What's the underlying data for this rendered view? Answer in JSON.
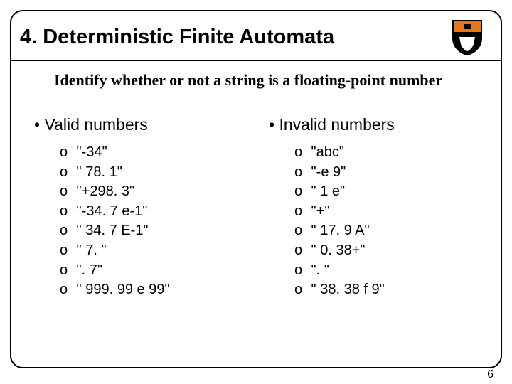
{
  "title": "4. Deterministic Finite Automata",
  "subtitle": "Identify whether or not a string is a floating-point number",
  "columns": [
    {
      "heading": "Valid numbers",
      "items": [
        "\"-34\"",
        "\" 78. 1\"",
        "\"+298. 3\"",
        "\"-34. 7 e-1\"",
        "\" 34. 7 E-1\"",
        "\" 7. \"",
        "\". 7\"",
        "\" 999. 99 e 99\""
      ]
    },
    {
      "heading": "Invalid numbers",
      "items": [
        "\"abc\"",
        "\"-e 9\"",
        "\" 1 e\"",
        "\"+\"",
        "\" 17. 9 A\"",
        "\" 0. 38+\"",
        "\". \"",
        "\" 38. 38 f 9\""
      ]
    }
  ],
  "page_number": "6"
}
